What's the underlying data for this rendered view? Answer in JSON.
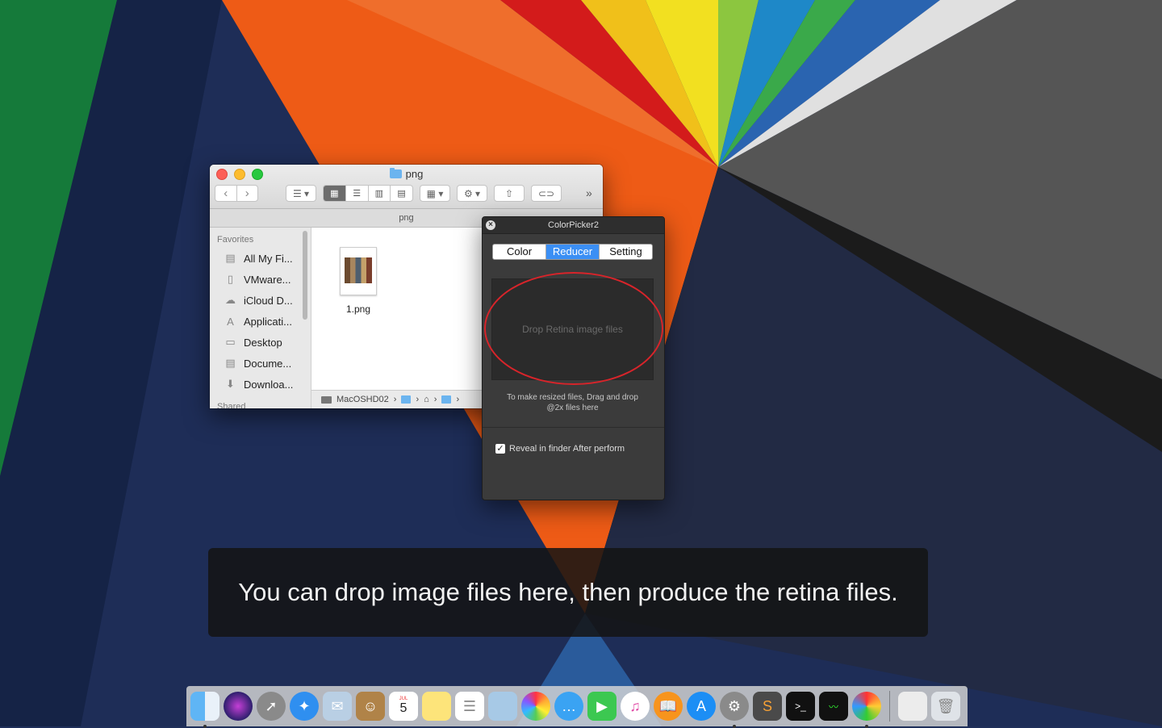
{
  "finder": {
    "title": "png",
    "path_title": "png",
    "sidebar_header": "Favorites",
    "sidebar_items": [
      {
        "label": "All My Fi...",
        "icon": "all-my-files-icon"
      },
      {
        "label": "VMware...",
        "icon": "document-icon"
      },
      {
        "label": "iCloud D...",
        "icon": "cloud-icon"
      },
      {
        "label": "Applicati...",
        "icon": "applications-icon"
      },
      {
        "label": "Desktop",
        "icon": "desktop-icon"
      },
      {
        "label": "Docume...",
        "icon": "documents-icon"
      },
      {
        "label": "Downloa...",
        "icon": "downloads-icon"
      }
    ],
    "sidebar_shared": "Shared",
    "file_name": "1.png",
    "statusbar_path": "MacOSHD02"
  },
  "colorpicker": {
    "title": "ColorPicker2",
    "tabs": [
      "Color",
      "Reducer",
      "Setting"
    ],
    "active_tab": "Reducer",
    "drop_label": "Drop Retina image files",
    "hint_line1": "To make resized files, Drag and drop",
    "hint_line2": "@2x files here",
    "reveal_label": "Reveal in finder After perform",
    "reveal_checked": true
  },
  "caption": "You can drop image files here, then produce the retina files.",
  "dock": {
    "apps": [
      "finder-icon",
      "siri-icon",
      "launchpad-icon",
      "safari-icon",
      "mail-icon",
      "contacts-icon",
      "calendar-icon",
      "notes-icon",
      "reminders-icon",
      "preview-icon",
      "photos-icon",
      "messages-icon",
      "facetime-icon",
      "itunes-icon",
      "ibooks-icon",
      "app-store-icon",
      "system-preferences-icon",
      "sublime-text-icon",
      "terminal-icon",
      "activity-monitor-icon",
      "colorpicker-icon"
    ],
    "calendar_month": "JUL",
    "calendar_day": "5"
  }
}
